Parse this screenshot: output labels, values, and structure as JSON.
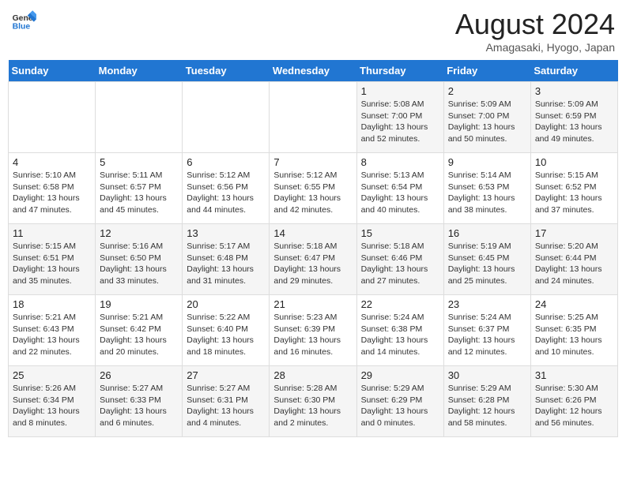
{
  "header": {
    "logo_general": "General",
    "logo_blue": "Blue",
    "month_title": "August 2024",
    "location": "Amagasaki, Hyogo, Japan"
  },
  "weekdays": [
    "Sunday",
    "Monday",
    "Tuesday",
    "Wednesday",
    "Thursday",
    "Friday",
    "Saturday"
  ],
  "weeks": [
    [
      {
        "day": "",
        "info": ""
      },
      {
        "day": "",
        "info": ""
      },
      {
        "day": "",
        "info": ""
      },
      {
        "day": "",
        "info": ""
      },
      {
        "day": "1",
        "info": "Sunrise: 5:08 AM\nSunset: 7:00 PM\nDaylight: 13 hours\nand 52 minutes."
      },
      {
        "day": "2",
        "info": "Sunrise: 5:09 AM\nSunset: 7:00 PM\nDaylight: 13 hours\nand 50 minutes."
      },
      {
        "day": "3",
        "info": "Sunrise: 5:09 AM\nSunset: 6:59 PM\nDaylight: 13 hours\nand 49 minutes."
      }
    ],
    [
      {
        "day": "4",
        "info": "Sunrise: 5:10 AM\nSunset: 6:58 PM\nDaylight: 13 hours\nand 47 minutes."
      },
      {
        "day": "5",
        "info": "Sunrise: 5:11 AM\nSunset: 6:57 PM\nDaylight: 13 hours\nand 45 minutes."
      },
      {
        "day": "6",
        "info": "Sunrise: 5:12 AM\nSunset: 6:56 PM\nDaylight: 13 hours\nand 44 minutes."
      },
      {
        "day": "7",
        "info": "Sunrise: 5:12 AM\nSunset: 6:55 PM\nDaylight: 13 hours\nand 42 minutes."
      },
      {
        "day": "8",
        "info": "Sunrise: 5:13 AM\nSunset: 6:54 PM\nDaylight: 13 hours\nand 40 minutes."
      },
      {
        "day": "9",
        "info": "Sunrise: 5:14 AM\nSunset: 6:53 PM\nDaylight: 13 hours\nand 38 minutes."
      },
      {
        "day": "10",
        "info": "Sunrise: 5:15 AM\nSunset: 6:52 PM\nDaylight: 13 hours\nand 37 minutes."
      }
    ],
    [
      {
        "day": "11",
        "info": "Sunrise: 5:15 AM\nSunset: 6:51 PM\nDaylight: 13 hours\nand 35 minutes."
      },
      {
        "day": "12",
        "info": "Sunrise: 5:16 AM\nSunset: 6:50 PM\nDaylight: 13 hours\nand 33 minutes."
      },
      {
        "day": "13",
        "info": "Sunrise: 5:17 AM\nSunset: 6:48 PM\nDaylight: 13 hours\nand 31 minutes."
      },
      {
        "day": "14",
        "info": "Sunrise: 5:18 AM\nSunset: 6:47 PM\nDaylight: 13 hours\nand 29 minutes."
      },
      {
        "day": "15",
        "info": "Sunrise: 5:18 AM\nSunset: 6:46 PM\nDaylight: 13 hours\nand 27 minutes."
      },
      {
        "day": "16",
        "info": "Sunrise: 5:19 AM\nSunset: 6:45 PM\nDaylight: 13 hours\nand 25 minutes."
      },
      {
        "day": "17",
        "info": "Sunrise: 5:20 AM\nSunset: 6:44 PM\nDaylight: 13 hours\nand 24 minutes."
      }
    ],
    [
      {
        "day": "18",
        "info": "Sunrise: 5:21 AM\nSunset: 6:43 PM\nDaylight: 13 hours\nand 22 minutes."
      },
      {
        "day": "19",
        "info": "Sunrise: 5:21 AM\nSunset: 6:42 PM\nDaylight: 13 hours\nand 20 minutes."
      },
      {
        "day": "20",
        "info": "Sunrise: 5:22 AM\nSunset: 6:40 PM\nDaylight: 13 hours\nand 18 minutes."
      },
      {
        "day": "21",
        "info": "Sunrise: 5:23 AM\nSunset: 6:39 PM\nDaylight: 13 hours\nand 16 minutes."
      },
      {
        "day": "22",
        "info": "Sunrise: 5:24 AM\nSunset: 6:38 PM\nDaylight: 13 hours\nand 14 minutes."
      },
      {
        "day": "23",
        "info": "Sunrise: 5:24 AM\nSunset: 6:37 PM\nDaylight: 13 hours\nand 12 minutes."
      },
      {
        "day": "24",
        "info": "Sunrise: 5:25 AM\nSunset: 6:35 PM\nDaylight: 13 hours\nand 10 minutes."
      }
    ],
    [
      {
        "day": "25",
        "info": "Sunrise: 5:26 AM\nSunset: 6:34 PM\nDaylight: 13 hours\nand 8 minutes."
      },
      {
        "day": "26",
        "info": "Sunrise: 5:27 AM\nSunset: 6:33 PM\nDaylight: 13 hours\nand 6 minutes."
      },
      {
        "day": "27",
        "info": "Sunrise: 5:27 AM\nSunset: 6:31 PM\nDaylight: 13 hours\nand 4 minutes."
      },
      {
        "day": "28",
        "info": "Sunrise: 5:28 AM\nSunset: 6:30 PM\nDaylight: 13 hours\nand 2 minutes."
      },
      {
        "day": "29",
        "info": "Sunrise: 5:29 AM\nSunset: 6:29 PM\nDaylight: 13 hours\nand 0 minutes."
      },
      {
        "day": "30",
        "info": "Sunrise: 5:29 AM\nSunset: 6:28 PM\nDaylight: 12 hours\nand 58 minutes."
      },
      {
        "day": "31",
        "info": "Sunrise: 5:30 AM\nSunset: 6:26 PM\nDaylight: 12 hours\nand 56 minutes."
      }
    ]
  ]
}
